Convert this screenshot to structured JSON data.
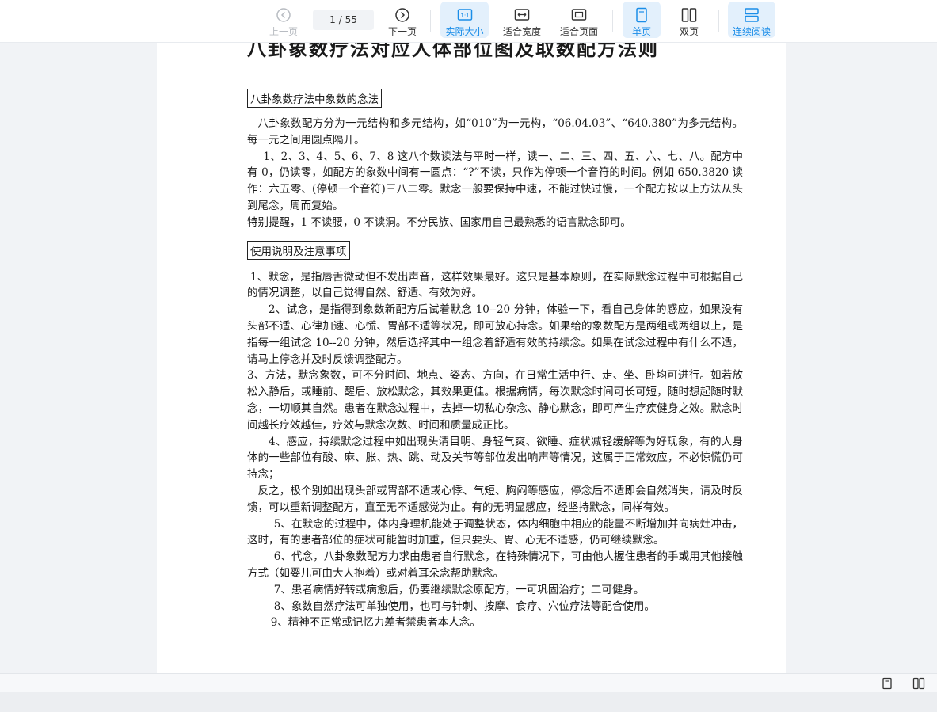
{
  "toolbar": {
    "prev_label": "上一页",
    "page_current": "1",
    "page_total": "/ 55",
    "next_label": "下一页",
    "actual_size_label": "实际大小",
    "fit_width_label": "适合宽度",
    "fit_page_label": "适合页面",
    "single_label": "单页",
    "double_label": "双页",
    "continuous_label": "连续阅读",
    "actual_size_glyph": "1:1"
  },
  "colors": {
    "accent": "#1a8de8",
    "active_bg": "#e3f0fc"
  },
  "document": {
    "title": "八卦象数疗法对应人体部位图及取数配方法则",
    "section1_heading": "八卦象数疗法中象数的念法",
    "section1_paras": [
      "八卦象数配方分为一元结构和多元结构，如“010”为一元构，“06.04.03”、“640.380”为多元结构。每一元之间用圆点隔开。",
      "1、2、3、4、5、6、7、8 这八个数读法与平时一样，读一、二、三、四、五、六、七、八。配方中有 0，仍读零，如配方的象数中间有一圆点：“?”不读，只作为停顿一个音符的时间。例如 650.3820 读作：六五零、(停顿一个音符)三八二零。默念一般要保持中速，不能过快过慢，一个配方按以上方法从头到尾念，周而复始。",
      "特别提醒，1 不读腰，0 不读洞。不分民族、国家用自己最熟悉的语言默念即可。"
    ],
    "section2_heading": "使用说明及注意事项",
    "section2_paras": [
      "1、默念，是指唇舌微动但不发出声音，这样效果最好。这只是基本原则，在实际默念过程中可根据自己的情况调整，以自己觉得自然、舒适、有效为好。",
      "2、试念，是指得到象数新配方后试着默念 10--20 分钟，体验一下，看自己身体的感应，如果没有头部不适、心律加速、心慌、胃部不适等状况，即可放心持念。如果给的象数配方是两组或两组以上，是指每一组试念 10--20 分钟，然后选择其中一组念着舒适有效的持续念。如果在试念过程中有什么不适，请马上停念并及时反馈调整配方。",
      "3、方法，默念象数，可不分时间、地点、姿态、方向，在日常生活中行、走、坐、卧均可进行。如若放松入静后，或睡前、醒后、放松默念，其效果更佳。根据病情，每次默念时间可长可短，随时想起随时默念，一切顺其自然。患者在默念过程中，去掉一切私心杂念、静心默念，即可产生疗疾健身之效。默念时间越长疗效越佳，疗效与默念次数、时间和质量成正比。",
      "4、感应，持续默念过程中如出现头清目明、身轻气爽、欲睡、症状减轻缓解等为好现象，有的人身体的一些部位有酸、麻、胀、热、跳、动及关节等部位发出响声等情况，这属于正常效应，不必惊慌仍可持念；",
      "反之，极个别如出现头部或胃部不适或心悸、气短、胸闷等感应，停念后不适即会自然消失，请及时反馈，可以重新调整配方，直至无不适感觉为止。有的无明显感应，经坚持默念，同样有效。",
      "5、在默念的过程中，体内身理机能处于调整状态，体内细胞中相应的能量不断增加并向病灶冲击，这时，有的患者部位的症状可能暂时加重，但只要头、胃、心无不适感，仍可继续默念。",
      "6、代念，八卦象数配方力求由患者自行默念，在特殊情况下，可由他人握住患者的手或用其他接触方式（如婴儿可由大人抱着）或对着耳朵念帮助默念。",
      "7、患者病情好转或病愈后，仍要继续默念原配方，一可巩固治疗；二可健身。",
      "8、象数自然疗法可单独使用，也可与针刺、按摩、食疗、穴位疗法等配合使用。",
      "9、精神不正常或记忆力差者禁患者本人念。"
    ]
  }
}
